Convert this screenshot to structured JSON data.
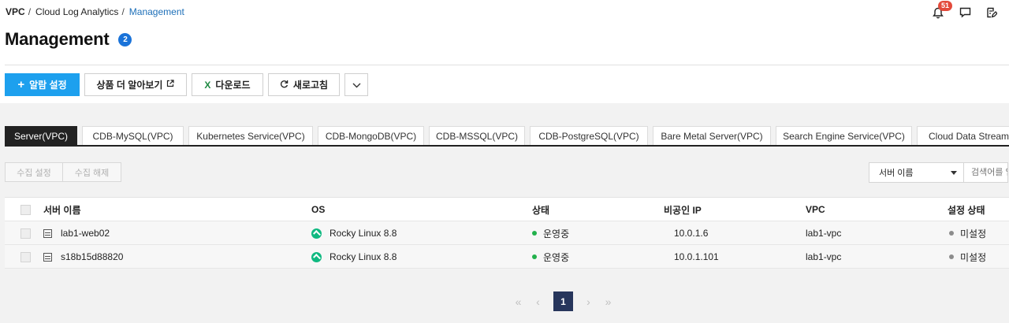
{
  "breadcrumb": [
    "VPC",
    "Cloud Log Analytics",
    "Management"
  ],
  "header": {
    "notification_count": "51",
    "icons": [
      "bell-icon",
      "chat-icon",
      "edit-note-icon"
    ]
  },
  "page": {
    "title": "Management",
    "count": "2"
  },
  "toolbar": {
    "alarm_label": "알람 설정",
    "learn_more_label": "상품 더 알아보기",
    "download_label": "다운로드",
    "refresh_label": "새로고침"
  },
  "tabs": [
    {
      "label": "Server(VPC)",
      "active": true
    },
    {
      "label": "CDB-MySQL(VPC)",
      "active": false
    },
    {
      "label": "Kubernetes Service(VPC)",
      "active": false
    },
    {
      "label": "CDB-MongoDB(VPC)",
      "active": false
    },
    {
      "label": "CDB-MSSQL(VPC)",
      "active": false
    },
    {
      "label": "CDB-PostgreSQL(VPC)",
      "active": false
    },
    {
      "label": "Bare Metal Server(VPC)",
      "active": false
    },
    {
      "label": "Search Engine Service(VPC)",
      "active": false
    },
    {
      "label": "Cloud Data Streaming",
      "active": false
    }
  ],
  "actions": {
    "collect_label": "수집 설정",
    "release_label": "수집 해제"
  },
  "search": {
    "select_value": "서버 이름",
    "placeholder": "검색어를 입력하세요"
  },
  "table": {
    "columns": [
      "서버 이름",
      "OS",
      "상태",
      "비공인 IP",
      "VPC",
      "설정 상태"
    ],
    "rows": [
      {
        "name": "lab1-web02",
        "os": "Rocky Linux 8.8",
        "status": "운영중",
        "ip": "10.0.1.6",
        "vpc": "lab1-vpc",
        "config": "미설정"
      },
      {
        "name": "s18b15d88820",
        "os": "Rocky Linux 8.8",
        "status": "운영중",
        "ip": "10.0.1.101",
        "vpc": "lab1-vpc",
        "config": "미설정"
      }
    ]
  },
  "pagination": {
    "current": "1"
  },
  "colors": {
    "primary": "#1da0ee",
    "accent_link": "#1d6fb8",
    "badge": "#e34a3b",
    "pager_active": "#27365c",
    "status_running": "#22b14c"
  }
}
